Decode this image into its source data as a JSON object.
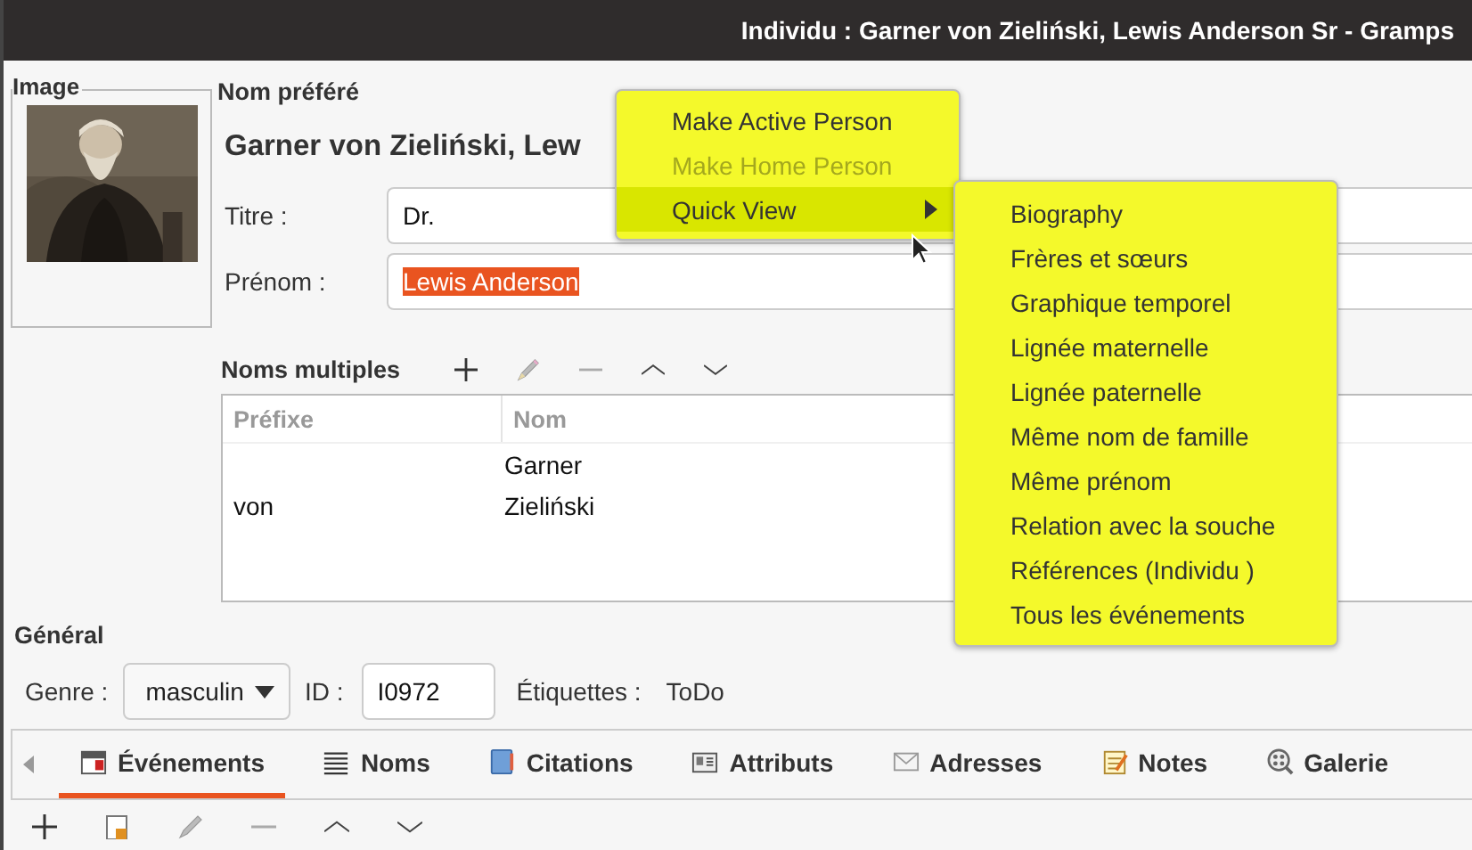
{
  "window": {
    "title": "Individu : Garner von Zieliński, Lewis Anderson Sr - Gramps"
  },
  "image_panel": {
    "label": "Image"
  },
  "preferred_name": {
    "heading": "Nom préféré",
    "display_name": "Garner von Zieliński, Lew",
    "title": {
      "label": "Titre :",
      "value": "Dr."
    },
    "given": {
      "label": "Prénom :",
      "value": "Lewis Anderson",
      "selected": true
    }
  },
  "multiple_names": {
    "heading": "Noms multiples",
    "columns": [
      "Préfixe",
      "Nom"
    ],
    "rows": [
      {
        "surname": "Garner"
      },
      {
        "prefix": "von",
        "surname": "Zieliński"
      }
    ]
  },
  "general": {
    "heading": "Général",
    "gender": {
      "label": "Genre :",
      "value": "masculin"
    },
    "id": {
      "label": "ID :",
      "value": "I0972"
    },
    "tags": {
      "label": "Étiquettes :",
      "value": "ToDo"
    }
  },
  "tabs": [
    {
      "label": "Événements",
      "kind": "calendar",
      "selected": true
    },
    {
      "label": "Noms",
      "kind": "list",
      "selected": false
    },
    {
      "label": "Citations",
      "kind": "book",
      "selected": false
    },
    {
      "label": "Attributs",
      "kind": "card",
      "selected": false
    },
    {
      "label": "Adresses",
      "kind": "envelope",
      "selected": false
    },
    {
      "label": "Notes",
      "kind": "notepad",
      "selected": false
    },
    {
      "label": "Galerie",
      "kind": "gallery",
      "selected": false
    }
  ],
  "context_menu": {
    "items": [
      {
        "label": "Make Active Person",
        "disabled": false,
        "selected": false,
        "has_submenu": false
      },
      {
        "label": "Make Home Person",
        "disabled": true,
        "selected": false,
        "has_submenu": false
      },
      {
        "label": "Quick View",
        "disabled": false,
        "selected": true,
        "has_submenu": true
      }
    ]
  },
  "quick_view_menu": {
    "items": [
      "Biography",
      "Frères et sœurs",
      "Graphique temporel",
      "Lignée maternelle",
      "Lignée paternelle",
      "Même nom de famille",
      "Même prénom",
      "Relation avec la souche",
      "Références (Individu )",
      "Tous les événements"
    ]
  }
}
